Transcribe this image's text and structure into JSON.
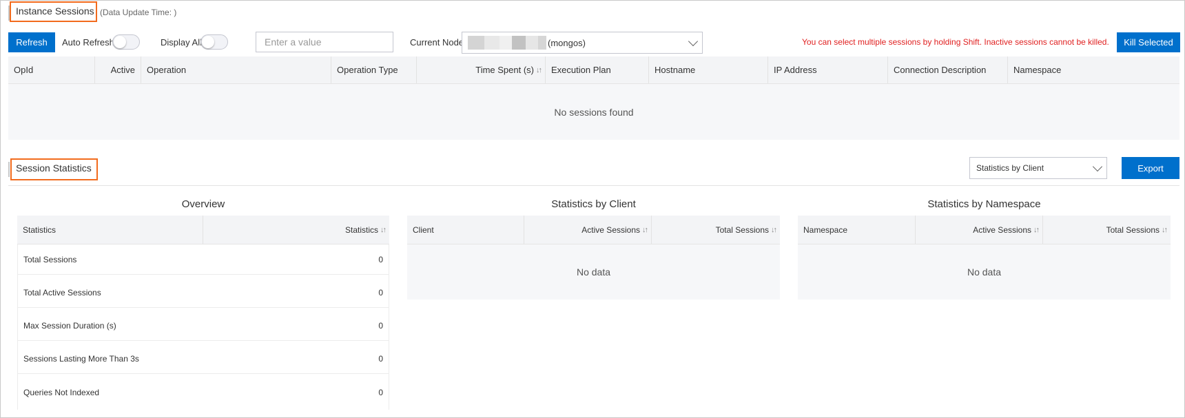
{
  "instance_sessions": {
    "title": "Instance Sessions",
    "update_time": "(Data Update Time: )",
    "toolbar": {
      "refresh": "Refresh",
      "auto_refresh": "Auto Refresh",
      "display_all": "Display All",
      "search_placeholder": "Enter a value",
      "current_node_label": "Current Node",
      "current_node_value": "(mongos)",
      "warning": "You can select multiple sessions by holding Shift. Inactive sessions cannot be killed.",
      "kill_selected": "Kill Selected"
    },
    "columns": [
      "OpId",
      "Active",
      "Operation",
      "Operation Type",
      "Time Spent (s)",
      "Execution Plan",
      "Hostname",
      "IP Address",
      "Connection Description",
      "Namespace"
    ],
    "empty_text": "No sessions found"
  },
  "session_statistics": {
    "title": "Session Statistics",
    "stats_select_value": "Statistics by Client",
    "export": "Export",
    "overview": {
      "title": "Overview",
      "columns": [
        "Statistics",
        "Statistics"
      ],
      "rows": [
        {
          "label": "Total Sessions",
          "value": "0"
        },
        {
          "label": "Total Active Sessions",
          "value": "0"
        },
        {
          "label": "Max Session Duration (s)",
          "value": "0"
        },
        {
          "label": "Sessions Lasting More Than 3s",
          "value": "0"
        },
        {
          "label": "Queries Not Indexed",
          "value": "0"
        }
      ]
    },
    "by_client": {
      "title": "Statistics by Client",
      "columns": [
        "Client",
        "Active Sessions",
        "Total Sessions"
      ],
      "empty_text": "No data"
    },
    "by_namespace": {
      "title": "Statistics by Namespace",
      "columns": [
        "Namespace",
        "Active Sessions",
        "Total Sessions"
      ],
      "empty_text": "No data"
    }
  },
  "colors": {
    "primary": "#0070cc",
    "highlight": "#f26b1d",
    "warning_text": "#e02020"
  }
}
